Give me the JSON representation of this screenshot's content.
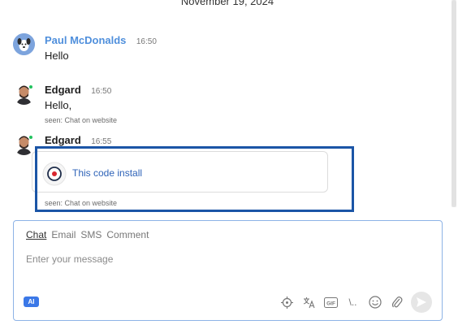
{
  "date_separator": "November 19, 2024",
  "messages": [
    {
      "sender": "Paul McDonalds",
      "time": "16:50",
      "text": "Hello"
    },
    {
      "sender": "Edgard",
      "time": "16:50",
      "text": "Hello,",
      "seen": "seen: Chat on website"
    },
    {
      "sender": "Edgard",
      "time": "16:55",
      "card_link": "This code install",
      "seen": "seen: Chat on website"
    }
  ],
  "composer": {
    "tabs": [
      "Chat",
      "Email",
      "SMS",
      "Comment"
    ],
    "active_tab": "Chat",
    "placeholder": "Enter your message",
    "ai_label": "AI",
    "tool_gif_label": "GIF",
    "tool_slash_label": "\\..",
    "tools": [
      "crosshair-icon",
      "translate-icon",
      "gif-icon",
      "slash-command-icon",
      "emoji-icon",
      "attachment-icon",
      "send-icon"
    ]
  },
  "colors": {
    "bot_sender": "#4f8fdc",
    "link": "#2e63b8",
    "highlight_border": "#1b55a6",
    "online": "#22c35e",
    "ai_badge": "#3b78e7",
    "composer_border": "#8db3e6"
  }
}
